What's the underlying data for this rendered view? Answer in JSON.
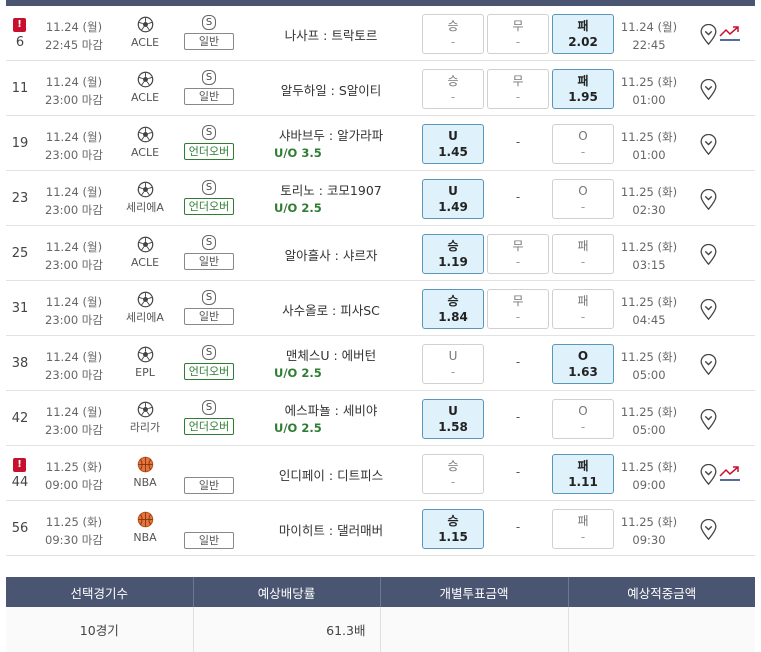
{
  "colors": {
    "header_bg": "#4a5572",
    "selected_bg": "#dff2fb",
    "alert": "#c8102e",
    "uo_green": "#2e7d32"
  },
  "rows": [
    {
      "alert": true,
      "num": "6",
      "deadline_date": "11.24 (월)",
      "deadline_time": "22:45 마감",
      "sport_icon": "soccer-ball-icon",
      "league": "ACLE",
      "type_badge": "S",
      "type": "일반",
      "uo": false,
      "teams": "나사프 : 트락토르",
      "uo_text": "",
      "cells": [
        {
          "label": "승",
          "odd": "-",
          "selected": false
        },
        {
          "label": "무",
          "odd": "-",
          "selected": false
        },
        {
          "label": "패",
          "odd": "2.02",
          "selected": true
        }
      ],
      "mid_dash": "",
      "result_date": "11.24 (월)",
      "result_time": "22:45",
      "trend": true
    },
    {
      "alert": false,
      "num": "11",
      "deadline_date": "11.24 (월)",
      "deadline_time": "23:00 마감",
      "sport_icon": "soccer-ball-icon",
      "league": "ACLE",
      "type_badge": "S",
      "type": "일반",
      "uo": false,
      "teams": "알두하일 : S알이티",
      "uo_text": "",
      "cells": [
        {
          "label": "승",
          "odd": "-",
          "selected": false
        },
        {
          "label": "무",
          "odd": "-",
          "selected": false
        },
        {
          "label": "패",
          "odd": "1.95",
          "selected": true
        }
      ],
      "mid_dash": "",
      "result_date": "11.25 (화)",
      "result_time": "01:00",
      "trend": false
    },
    {
      "alert": false,
      "num": "19",
      "deadline_date": "11.24 (월)",
      "deadline_time": "23:00 마감",
      "sport_icon": "soccer-ball-icon",
      "league": "ACLE",
      "type_badge": "S",
      "type": "언더오버",
      "uo": true,
      "teams": "샤바브두 : 알가라파",
      "uo_text": "U/O 3.5",
      "cells": [
        {
          "label": "U",
          "odd": "1.45",
          "selected": true
        },
        null,
        {
          "label": "O",
          "odd": "-",
          "selected": false
        }
      ],
      "mid_dash": "-",
      "result_date": "11.25 (화)",
      "result_time": "01:00",
      "trend": false
    },
    {
      "alert": false,
      "num": "23",
      "deadline_date": "11.24 (월)",
      "deadline_time": "23:00 마감",
      "sport_icon": "soccer-ball-icon",
      "league": "세리에A",
      "type_badge": "S",
      "type": "언더오버",
      "uo": true,
      "teams": "토리노 : 코모1907",
      "uo_text": "U/O 2.5",
      "cells": [
        {
          "label": "U",
          "odd": "1.49",
          "selected": true
        },
        null,
        {
          "label": "O",
          "odd": "-",
          "selected": false
        }
      ],
      "mid_dash": "-",
      "result_date": "11.25 (화)",
      "result_time": "02:30",
      "trend": false
    },
    {
      "alert": false,
      "num": "25",
      "deadline_date": "11.24 (월)",
      "deadline_time": "23:00 마감",
      "sport_icon": "soccer-ball-icon",
      "league": "ACLE",
      "type_badge": "S",
      "type": "일반",
      "uo": false,
      "teams": "알아흘사 : 샤르자",
      "uo_text": "",
      "cells": [
        {
          "label": "승",
          "odd": "1.19",
          "selected": true
        },
        {
          "label": "무",
          "odd": "-",
          "selected": false
        },
        {
          "label": "패",
          "odd": "-",
          "selected": false
        }
      ],
      "mid_dash": "",
      "result_date": "11.25 (화)",
      "result_time": "03:15",
      "trend": false
    },
    {
      "alert": false,
      "num": "31",
      "deadline_date": "11.24 (월)",
      "deadline_time": "23:00 마감",
      "sport_icon": "soccer-ball-icon",
      "league": "세리에A",
      "type_badge": "S",
      "type": "일반",
      "uo": false,
      "teams": "사수올로 : 피사SC",
      "uo_text": "",
      "cells": [
        {
          "label": "승",
          "odd": "1.84",
          "selected": true
        },
        {
          "label": "무",
          "odd": "-",
          "selected": false
        },
        {
          "label": "패",
          "odd": "-",
          "selected": false
        }
      ],
      "mid_dash": "",
      "result_date": "11.25 (화)",
      "result_time": "04:45",
      "trend": false
    },
    {
      "alert": false,
      "num": "38",
      "deadline_date": "11.24 (월)",
      "deadline_time": "23:00 마감",
      "sport_icon": "soccer-ball-icon",
      "league": "EPL",
      "type_badge": "S",
      "type": "언더오버",
      "uo": true,
      "teams": "맨체스U : 에버턴",
      "uo_text": "U/O 2.5",
      "cells": [
        {
          "label": "U",
          "odd": "-",
          "selected": false
        },
        null,
        {
          "label": "O",
          "odd": "1.63",
          "selected": true
        }
      ],
      "mid_dash": "-",
      "result_date": "11.25 (화)",
      "result_time": "05:00",
      "trend": false
    },
    {
      "alert": false,
      "num": "42",
      "deadline_date": "11.24 (월)",
      "deadline_time": "23:00 마감",
      "sport_icon": "soccer-ball-icon",
      "league": "라리가",
      "type_badge": "S",
      "type": "언더오버",
      "uo": true,
      "teams": "에스파뇰 : 세비야",
      "uo_text": "U/O 2.5",
      "cells": [
        {
          "label": "U",
          "odd": "1.58",
          "selected": true
        },
        null,
        {
          "label": "O",
          "odd": "-",
          "selected": false
        }
      ],
      "mid_dash": "-",
      "result_date": "11.25 (화)",
      "result_time": "05:00",
      "trend": false
    },
    {
      "alert": true,
      "num": "44",
      "deadline_date": "11.25 (화)",
      "deadline_time": "09:00 마감",
      "sport_icon": "basketball-icon",
      "league": "NBA",
      "type_badge": "",
      "type": "일반",
      "uo": false,
      "teams": "인디페이 : 디트피스",
      "uo_text": "",
      "cells": [
        {
          "label": "승",
          "odd": "-",
          "selected": false
        },
        null,
        {
          "label": "패",
          "odd": "1.11",
          "selected": true
        }
      ],
      "mid_dash": "-",
      "result_date": "11.25 (화)",
      "result_time": "09:00",
      "trend": true
    },
    {
      "alert": false,
      "num": "56",
      "deadline_date": "11.25 (화)",
      "deadline_time": "09:30 마감",
      "sport_icon": "basketball-icon",
      "league": "NBA",
      "type_badge": "",
      "type": "일반",
      "uo": false,
      "teams": "마이히트 : 댈러매버",
      "uo_text": "",
      "cells": [
        {
          "label": "승",
          "odd": "1.15",
          "selected": true
        },
        null,
        {
          "label": "패",
          "odd": "-",
          "selected": false
        }
      ],
      "mid_dash": "-",
      "result_date": "11.25 (화)",
      "result_time": "09:30",
      "trend": false
    }
  ],
  "summary": {
    "headers": [
      "선택경기수",
      "예상배당률",
      "개별투표금액",
      "예상적중금액"
    ],
    "count": "10경기",
    "odds": "61.3배",
    "amount": "",
    "expected": ""
  }
}
